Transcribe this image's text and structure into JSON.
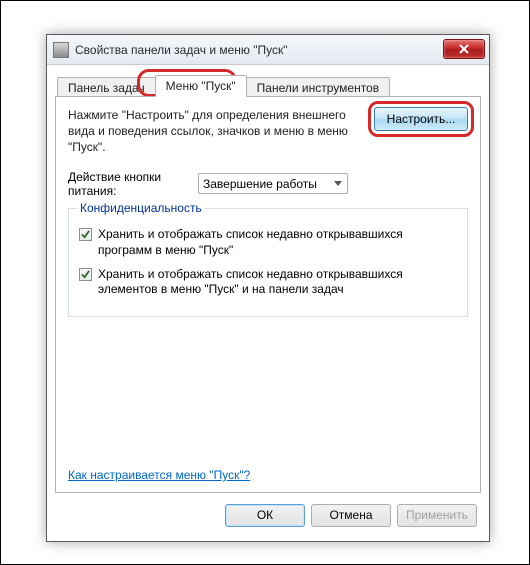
{
  "window": {
    "title": "Свойства панели задач и меню \"Пуск\""
  },
  "tabs": {
    "taskbar": "Панель задач",
    "startmenu": "Меню \"Пуск\"",
    "toolbars": "Панели инструментов"
  },
  "main": {
    "description": "Нажмите \"Настроить\" для определения внешнего вида и поведения ссылок, значков и меню в меню \"Пуск\".",
    "configure_label": "Настроить...",
    "power_label": "Действие кнопки питания:",
    "power_value": "Завершение работы"
  },
  "privacy": {
    "group_title": "Конфиденциальность",
    "check1": "Хранить и отображать список недавно открывавшихся программ в меню \"Пуск\"",
    "check2": "Хранить и отображать список недавно открывавшихся элементов в меню \"Пуск\" и на панели задач"
  },
  "help_link": "Как настраивается меню \"Пуск\"?",
  "buttons": {
    "ok": "ОК",
    "cancel": "Отмена",
    "apply": "Применить"
  }
}
